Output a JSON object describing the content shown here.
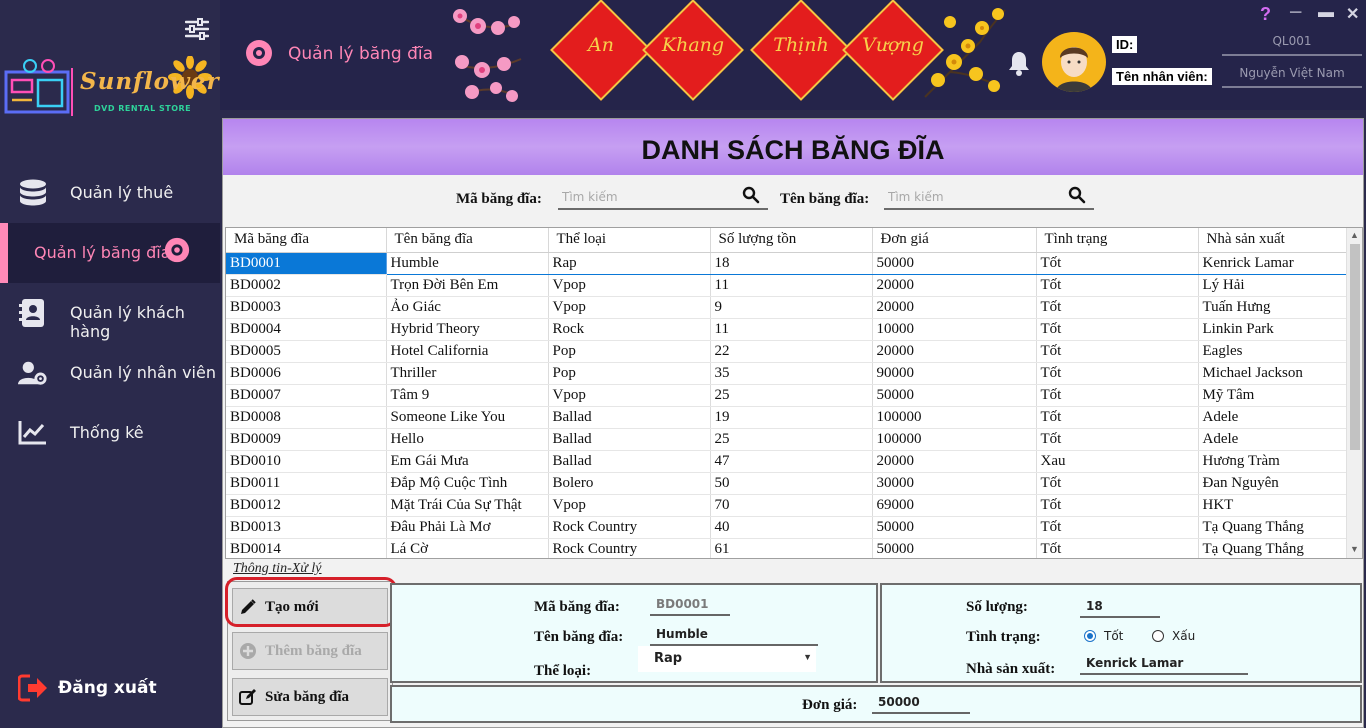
{
  "app": {
    "logo_text": "Sunflower",
    "logo_subtitle": "DVD RENTAL STORE"
  },
  "sidebar": {
    "items": [
      {
        "label": "Quản lý thuê",
        "icon": "database-icon"
      },
      {
        "label": "Quản lý băng đĩa",
        "icon": "disc-icon"
      },
      {
        "label": "Quản lý khách hàng",
        "icon": "address-book-icon"
      },
      {
        "label": "Quản lý nhân viên",
        "icon": "user-gear-icon"
      },
      {
        "label": "Thống kê",
        "icon": "chart-line-icon"
      }
    ],
    "logout_label": "Đăng xuất"
  },
  "header": {
    "module_title": "Quản lý băng đĩa",
    "banner_words": [
      "An",
      "Khang",
      "Thịnh",
      "Vượng"
    ],
    "id_label": "ID:",
    "id_value": "QL001",
    "employee_label": "Tên nhân viên:",
    "employee_value": "Nguyễn Việt Nam",
    "window_buttons": [
      "?",
      "─",
      "▬",
      "✕"
    ]
  },
  "main": {
    "title": "DANH SÁCH BĂNG ĐĨA",
    "search_code_label": "Mã băng đĩa:",
    "search_code_placeholder": "Tìm kiếm",
    "search_name_label": "Tên băng đĩa:",
    "search_name_placeholder": "Tìm kiếm"
  },
  "table": {
    "columns": [
      "Mã băng đĩa",
      "Tên băng đĩa",
      "Thể loại",
      "Số lượng tồn",
      "Đơn giá",
      "Tình trạng",
      "Nhà sản xuất"
    ],
    "rows": [
      [
        "BD0001",
        "Humble",
        "Rap",
        "18",
        "50000",
        "Tốt",
        "Kenrick Lamar"
      ],
      [
        "BD0002",
        "Trọn Đời Bên Em",
        "Vpop",
        "11",
        "20000",
        "Tốt",
        "Lý Hải"
      ],
      [
        "BD0003",
        "Ảo Giác",
        "Vpop",
        "9",
        "20000",
        "Tốt",
        "Tuấn Hưng"
      ],
      [
        "BD0004",
        "Hybrid Theory",
        "Rock",
        "11",
        "10000",
        "Tốt",
        "Linkin Park"
      ],
      [
        "BD0005",
        "Hotel California",
        "Pop",
        "22",
        "20000",
        "Tốt",
        "Eagles"
      ],
      [
        "BD0006",
        "Thriller",
        "Pop",
        "35",
        "90000",
        "Tốt",
        "Michael Jackson"
      ],
      [
        "BD0007",
        "Tâm 9",
        "Vpop",
        "25",
        "50000",
        "Tốt",
        "Mỹ Tâm"
      ],
      [
        "BD0008",
        "Someone Like You",
        "Ballad",
        "19",
        "100000",
        "Tốt",
        "Adele"
      ],
      [
        "BD0009",
        "Hello",
        "Ballad",
        "25",
        "100000",
        "Tốt",
        "Adele"
      ],
      [
        "BD0010",
        "Em Gái Mưa",
        "Ballad",
        "47",
        "20000",
        "Xau",
        "Hương Tràm"
      ],
      [
        "BD0011",
        "Đắp Mộ Cuộc Tình",
        "Bolero",
        "50",
        "30000",
        "Tốt",
        "Đan Nguyên"
      ],
      [
        "BD0012",
        "Mặt Trái Của Sự Thật",
        "Vpop",
        "70",
        "69000",
        "Tốt",
        "HKT"
      ],
      [
        "BD0013",
        "Đâu Phải Là Mơ",
        "Rock Country",
        "40",
        "50000",
        "Tốt",
        "Tạ Quang Thắng"
      ],
      [
        "BD0014",
        "Lá Cờ",
        "Rock Country",
        "61",
        "50000",
        "Tốt",
        "Tạ Quang Thắng"
      ]
    ],
    "selected_row": 0
  },
  "form": {
    "section_label": "Thông tin-Xử lý",
    "btn_new": "Tạo mới",
    "btn_add": "Thêm băng đĩa",
    "btn_edit": "Sửa băng đĩa",
    "code_label": "Mã băng đĩa:",
    "code_value": "BD0001",
    "name_label": "Tên băng đĩa:",
    "name_value": "Humble",
    "genre_label": "Thể loại:",
    "genre_value": "Rap",
    "qty_label": "Số lượng:",
    "qty_value": "18",
    "status_label": "Tình trạng:",
    "status_good": "Tốt",
    "status_bad": "Xấu",
    "producer_label": "Nhà sản xuất:",
    "producer_value": "Kenrick Lamar",
    "price_label": "Đơn giá:",
    "price_value": "50000"
  },
  "colors": {
    "sidebar_bg": "#2b2a4c",
    "accent_pink": "#ff86b6",
    "title_purple": "#b786f0",
    "selection_blue": "#0a78d7",
    "form_bg": "#eefdfd",
    "highlight_red": "#d6202a"
  }
}
